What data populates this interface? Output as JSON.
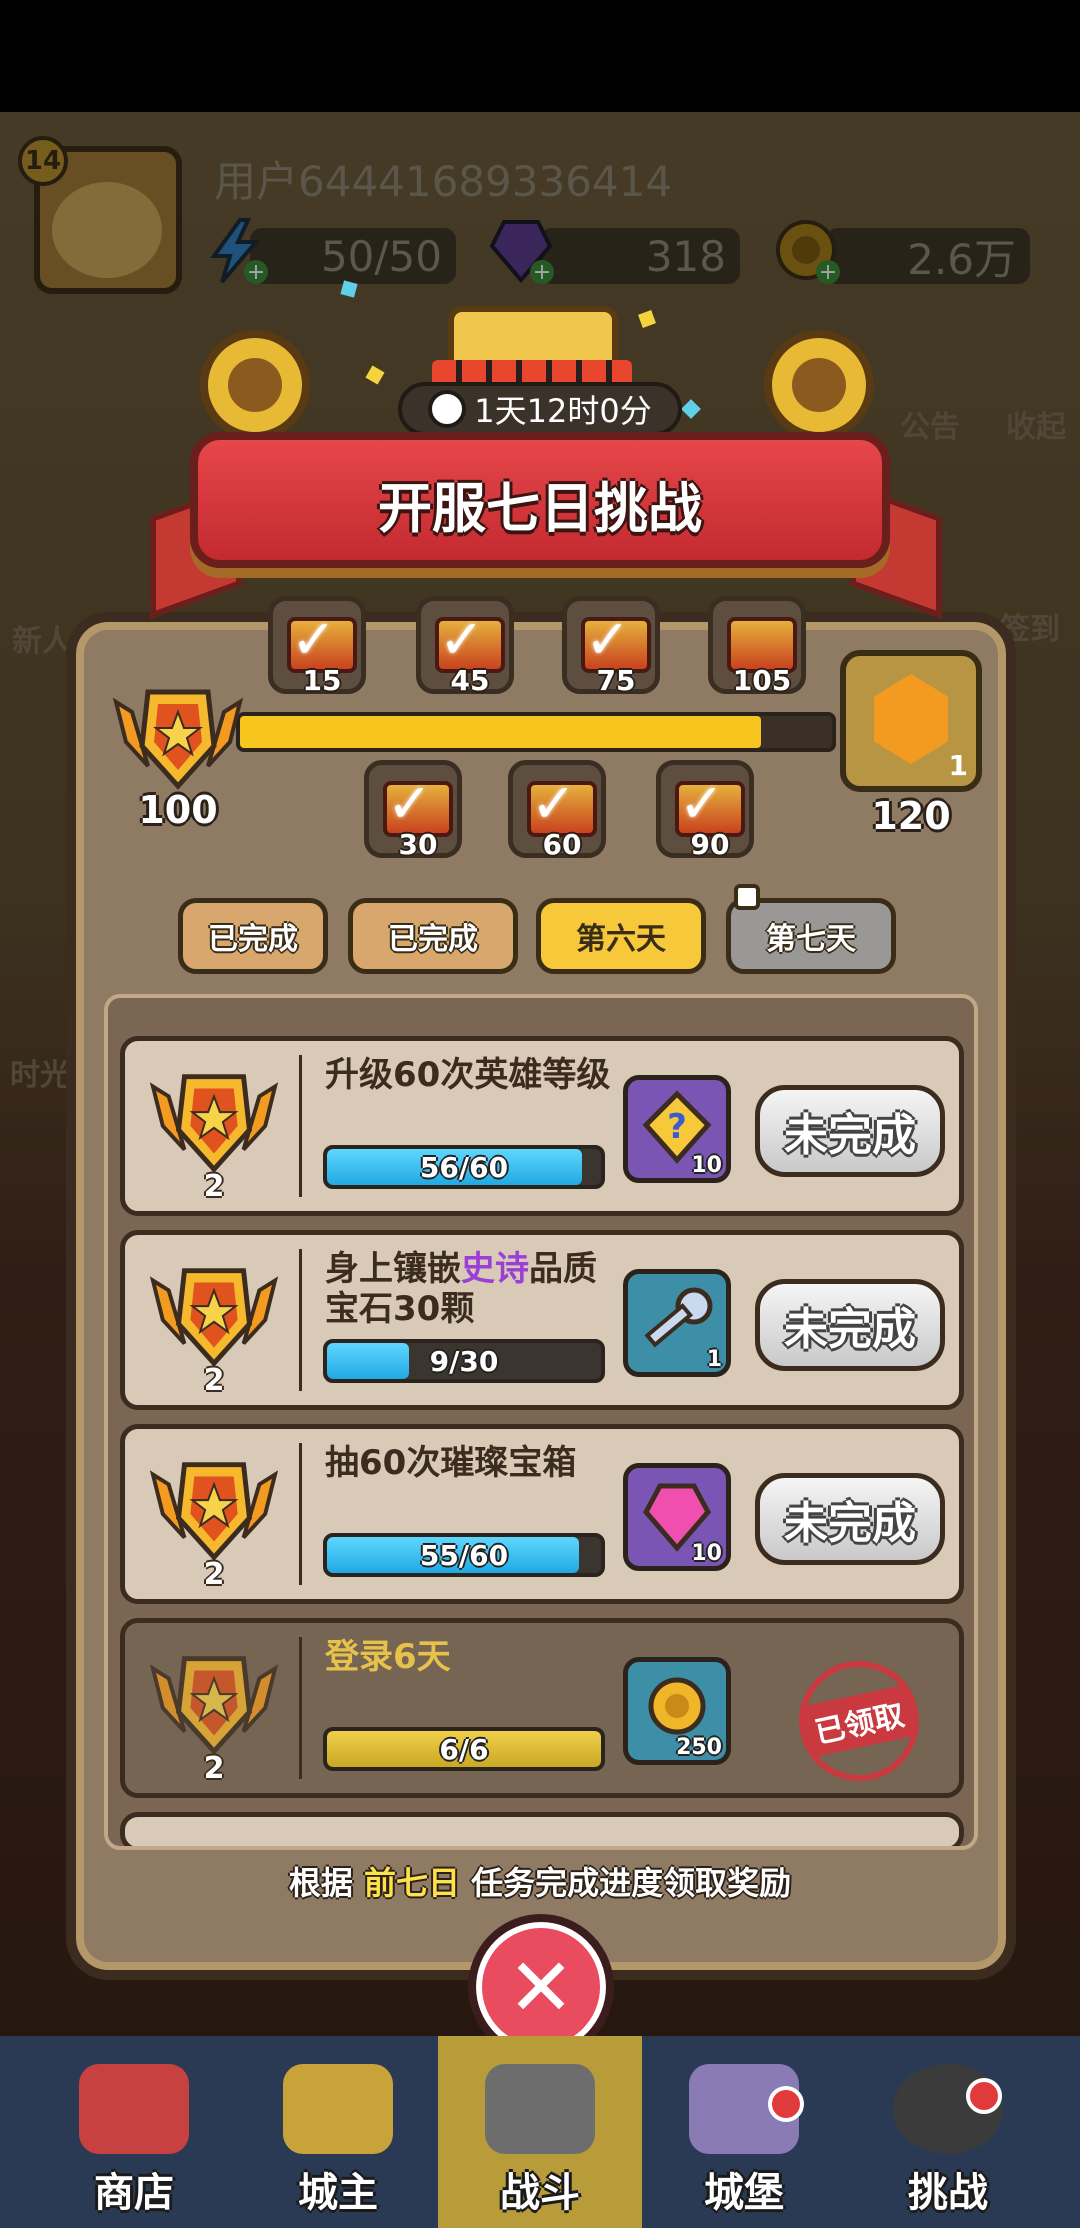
{
  "header": {
    "level": "14",
    "username": "用户64441689336414",
    "energy": "50/50",
    "gems": "318",
    "gold": "2.6万"
  },
  "side": {
    "left": [
      "新人",
      "时光"
    ],
    "right": [
      "公告",
      "收起",
      "签到"
    ]
  },
  "event": {
    "timer": "1天12时0分",
    "title": "开服七日挑战",
    "score_start": "100",
    "score_end": "120",
    "end_reward_count": "1",
    "progress": 0.88,
    "milestones_top": [
      "15",
      "45",
      "75",
      "105"
    ],
    "milestones_bottom": [
      "30",
      "60",
      "90"
    ]
  },
  "tabs": [
    {
      "label": "已完成",
      "state": "done"
    },
    {
      "label": "已完成",
      "state": "done"
    },
    {
      "label": "第六天",
      "state": "active"
    },
    {
      "label": "第七天",
      "state": "locked"
    }
  ],
  "tasks": [
    {
      "points": "2",
      "title": "升级60次英雄等级",
      "progress_text": "56/60",
      "progress": 0.93,
      "reward_count": "10",
      "reward_icon": "hero-fragment-icon",
      "status": "未完成"
    },
    {
      "points": "2",
      "title_pre": "身上镶嵌",
      "title_hl": "史诗",
      "title_post": "品质宝石30颗",
      "progress_text": "9/30",
      "progress": 0.3,
      "reward_count": "1",
      "reward_icon": "key-icon",
      "status": "未完成"
    },
    {
      "points": "2",
      "title": "抽60次璀璨宝箱",
      "progress_text": "55/60",
      "progress": 0.92,
      "reward_count": "10",
      "reward_icon": "pink-gem-icon",
      "status": "未完成"
    },
    {
      "points": "2",
      "title": "登录6天",
      "progress_text": "6/6",
      "progress": 1.0,
      "reward_count": "250",
      "reward_icon": "gold-coin-icon",
      "status": "已领取"
    }
  ],
  "footnote": {
    "pre": "根据",
    "highlight": "前七日",
    "post": "任务完成进度领取奖励"
  },
  "nav": [
    {
      "label": "商店"
    },
    {
      "label": "城主"
    },
    {
      "label": "战斗"
    },
    {
      "label": "城堡"
    },
    {
      "label": "挑战"
    }
  ]
}
